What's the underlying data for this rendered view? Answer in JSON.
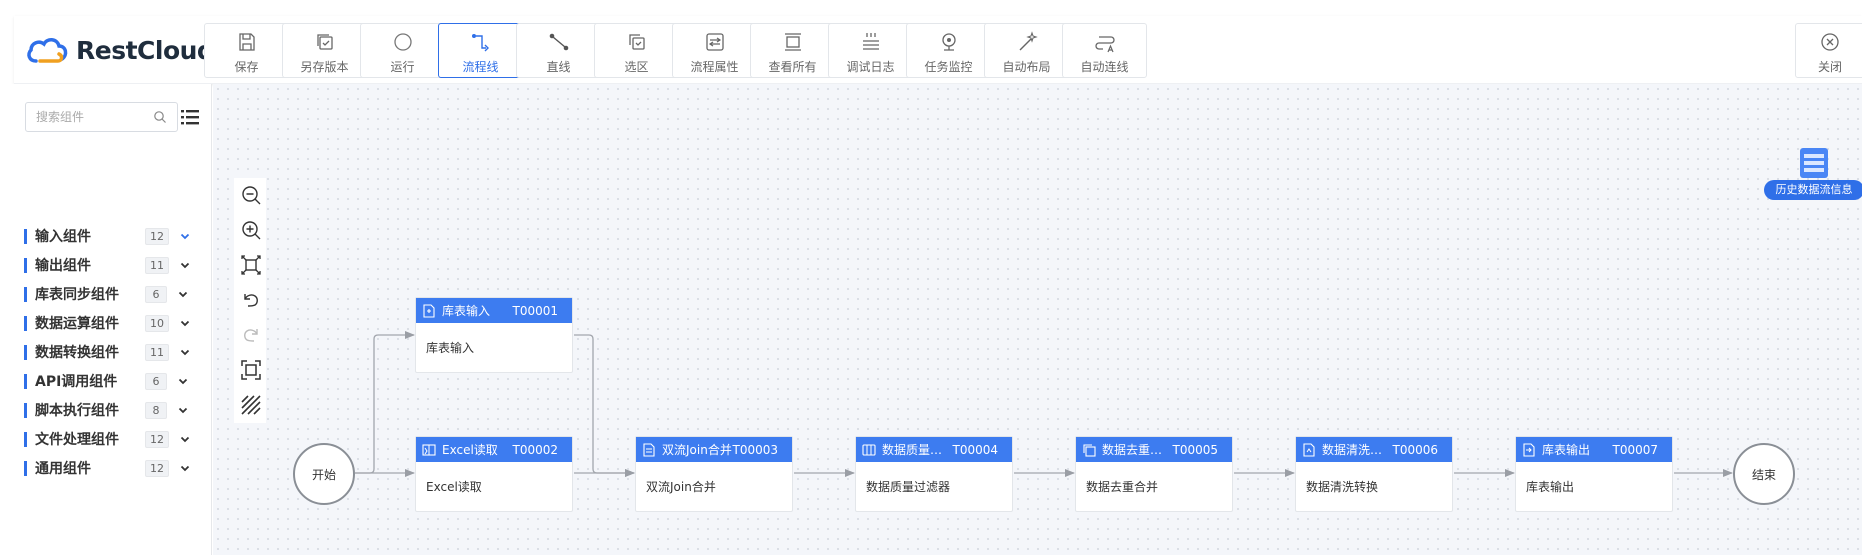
{
  "app": {
    "logo_text": "RestCloud"
  },
  "toolbar": {
    "items": [
      {
        "label": "保存",
        "icon": "save-icon"
      },
      {
        "label": "另存版本",
        "icon": "save-version-icon"
      },
      {
        "label": "运行",
        "icon": "run-icon"
      },
      {
        "label": "流程线",
        "icon": "flow-line-icon",
        "active": true
      },
      {
        "label": "直线",
        "icon": "straight-line-icon"
      },
      {
        "label": "选区",
        "icon": "selection-icon"
      },
      {
        "label": "流程属性",
        "icon": "flow-properties-icon"
      },
      {
        "label": "查看所有",
        "icon": "view-all-icon"
      },
      {
        "label": "调试日志",
        "icon": "debug-log-icon"
      },
      {
        "label": "任务监控",
        "icon": "task-monitor-icon"
      },
      {
        "label": "自动布局",
        "icon": "auto-layout-icon"
      },
      {
        "label": "自动连线",
        "icon": "auto-connect-icon"
      }
    ],
    "close_label": "关闭"
  },
  "sidebar": {
    "search_placeholder": "搜索组件",
    "categories": [
      {
        "name": "输入组件",
        "count": "12",
        "expanded": true
      },
      {
        "name": "输出组件",
        "count": "11"
      },
      {
        "name": "库表同步组件",
        "count": "6"
      },
      {
        "name": "数据运算组件",
        "count": "10"
      },
      {
        "name": "数据转换组件",
        "count": "11"
      },
      {
        "name": "API调用组件",
        "count": "6"
      },
      {
        "name": "脚本执行组件",
        "count": "8"
      },
      {
        "name": "文件处理组件",
        "count": "12"
      },
      {
        "name": "通用组件",
        "count": "12"
      }
    ]
  },
  "canvas": {
    "start_label": "开始",
    "end_label": "结束",
    "history_label": "历史数据流信息",
    "nodes": [
      {
        "title": "库表输入",
        "id": "T00001",
        "body": "库表输入"
      },
      {
        "title": "Excel读取",
        "id": "T00002",
        "body": "Excel读取"
      },
      {
        "title": "双流Join合并",
        "id": "T00003",
        "body": "双流Join合并"
      },
      {
        "title": "数据质量过滤器",
        "id": "T00004",
        "body": "数据质量过滤器"
      },
      {
        "title": "数据去重合并",
        "id": "T00005",
        "body": "数据去重合并"
      },
      {
        "title": "数据清洗转换",
        "id": "T00006",
        "body": "数据清洗转换"
      },
      {
        "title": "库表输出",
        "id": "T00007",
        "body": "库表输出"
      }
    ]
  },
  "colors": {
    "accent": "#2f6fe8",
    "node_header": "#3d7cf0",
    "edge": "#9a9ea5"
  }
}
